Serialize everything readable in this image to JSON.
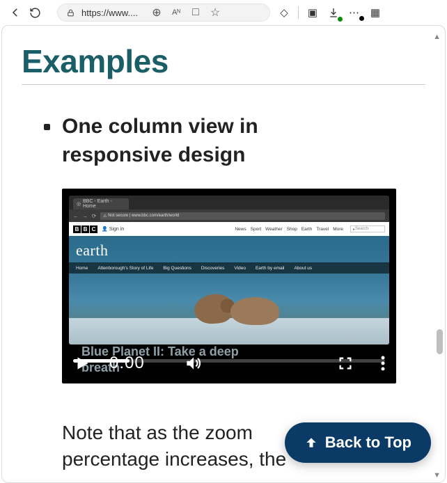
{
  "chrome": {
    "url": "https://www....",
    "addr_tools": {
      "zoom": "⊕",
      "read": "Aᴺ",
      "reader": "□",
      "fav": "☆"
    },
    "right": {
      "ext": "◇",
      "split": "▣",
      "down": "↓",
      "more": "⋯",
      "shield": "▦"
    }
  },
  "page": {
    "title": "Examples",
    "item_heading": "One column view in responsive design",
    "note": "Note that as the zoom percentage increases, the"
  },
  "video": {
    "time": "0:00",
    "tab_label": "BBC - Earth - Home",
    "url_text": "Not secure | www.bbc.com/earth/world",
    "bbc_signin": "Sign in",
    "bbc_nav": [
      "News",
      "Sport",
      "Weather",
      "Shop",
      "Earth",
      "Travel",
      "More"
    ],
    "bbc_search": "Search",
    "earth_title": "earth",
    "bbc_subnav": [
      "Home",
      "Attenborough's Story of Life",
      "Big Questions",
      "Discoveries",
      "Video",
      "Earth by email",
      "About us"
    ],
    "hero_line": "Blue Planet II: Take a deep breath"
  },
  "back_to_top": "Back to Top"
}
